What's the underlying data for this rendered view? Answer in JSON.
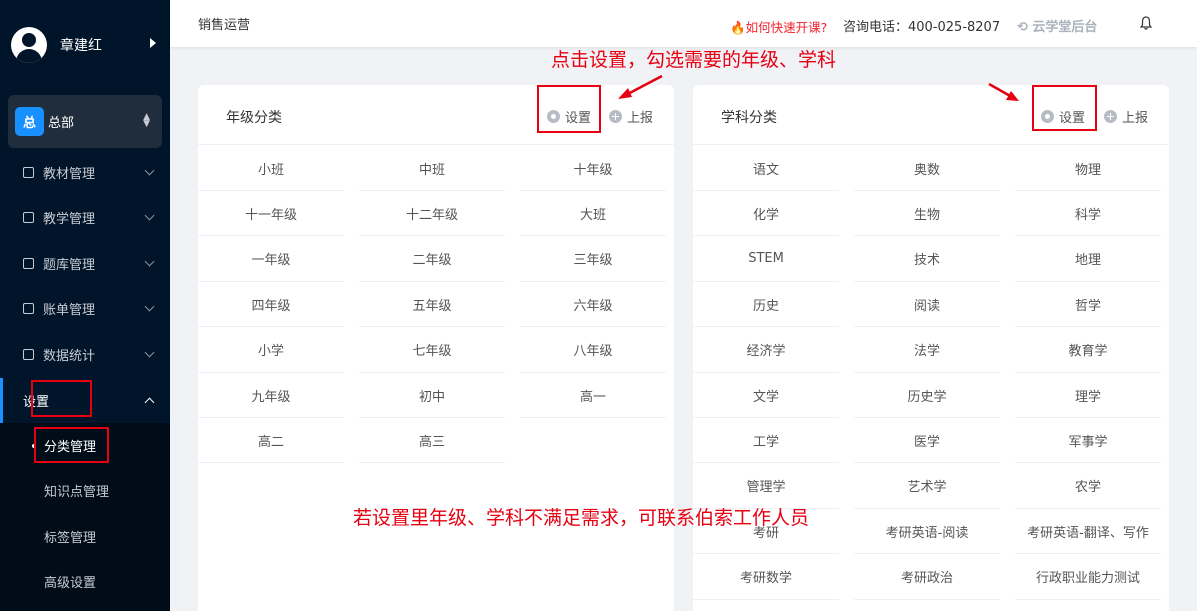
{
  "sidebar": {
    "user_name": "章建红",
    "org": {
      "badge": "总",
      "name": "总部"
    },
    "menu": [
      {
        "label": "教材管理"
      },
      {
        "label": "教学管理"
      },
      {
        "label": "题库管理"
      },
      {
        "label": "账单管理"
      },
      {
        "label": "数据统计"
      },
      {
        "label": "设置"
      }
    ],
    "submenu": [
      {
        "label": "分类管理"
      },
      {
        "label": "知识点管理"
      },
      {
        "label": "标签管理"
      },
      {
        "label": "高级设置"
      }
    ]
  },
  "header": {
    "page_title": "销售运营",
    "quick_link": "如何快速开课?",
    "phone": "咨询电话：400-025-8207",
    "brand": "云学堂后台"
  },
  "grade_card": {
    "title": "年级分类",
    "settings_label": "设置",
    "report_label": "上报",
    "items": [
      "小班",
      "中班",
      "十年级",
      "十一年级",
      "十二年级",
      "大班",
      "一年级",
      "二年级",
      "三年级",
      "四年级",
      "五年级",
      "六年级",
      "小学",
      "七年级",
      "八年级",
      "九年级",
      "初中",
      "高一",
      "高二",
      "高三"
    ]
  },
  "subject_card": {
    "title": "学科分类",
    "settings_label": "设置",
    "report_label": "上报",
    "items": [
      "语文",
      "奥数",
      "物理",
      "化学",
      "生物",
      "科学",
      "STEM",
      "技术",
      "地理",
      "历史",
      "阅读",
      "哲学",
      "经济学",
      "法学",
      "教育学",
      "文学",
      "历史学",
      "理学",
      "工学",
      "医学",
      "军事学",
      "管理学",
      "艺术学",
      "农学",
      "考研",
      "考研英语-阅读",
      "考研英语-翻译、写作",
      "考研数学",
      "考研政治",
      "行政职业能力测试"
    ]
  },
  "annotations": {
    "top_note": "点击设置，勾选需要的年级、学科",
    "bottom_note": "若设置里年级、学科不满足需求，可联系伯索工作人员",
    "color": "#e60012"
  }
}
